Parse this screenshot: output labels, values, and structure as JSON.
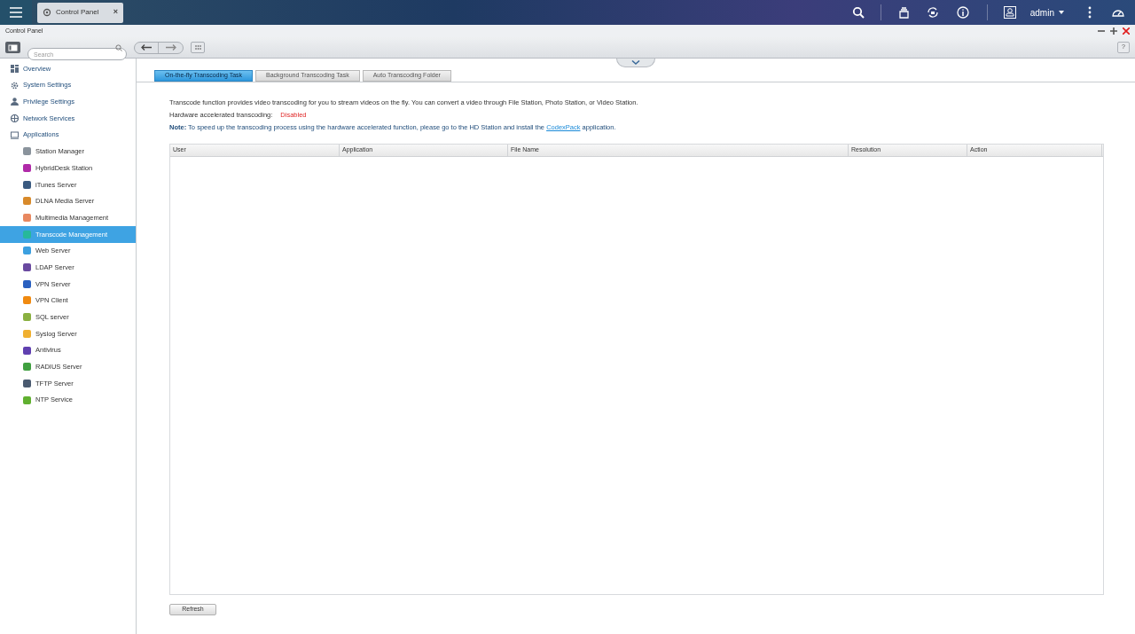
{
  "taskbar": {
    "app_tab": "Control Panel",
    "close": "×",
    "user": "admin"
  },
  "help": "?",
  "window": {
    "title": "Control Panel"
  },
  "search": {
    "placeholder": "Search"
  },
  "sidebar": {
    "items": [
      {
        "label": "Overview",
        "selected": false
      },
      {
        "label": "System Settings",
        "selected": false
      },
      {
        "label": "Privilege Settings",
        "selected": false
      },
      {
        "label": "Network Services",
        "selected": false
      },
      {
        "label": "Applications",
        "selected": false,
        "children": [
          {
            "label": "Station Manager",
            "selected": false
          },
          {
            "label": "HybridDesk Station",
            "selected": false
          },
          {
            "label": "iTunes Server",
            "selected": false
          },
          {
            "label": "DLNA Media Server",
            "selected": false
          },
          {
            "label": "Multimedia Management",
            "selected": false
          },
          {
            "label": "Transcode Management",
            "selected": true
          },
          {
            "label": "Web Server",
            "selected": false
          },
          {
            "label": "LDAP Server",
            "selected": false
          },
          {
            "label": "VPN Server",
            "selected": false
          },
          {
            "label": "VPN Client",
            "selected": false
          },
          {
            "label": "SQL server",
            "selected": false
          },
          {
            "label": "Syslog Server",
            "selected": false
          },
          {
            "label": "Antivirus",
            "selected": false
          },
          {
            "label": "RADIUS Server",
            "selected": false
          },
          {
            "label": "TFTP Server",
            "selected": false
          },
          {
            "label": "NTP Service",
            "selected": false
          }
        ]
      }
    ]
  },
  "tabs": [
    {
      "label": "On-the-fly Transcoding Task",
      "selected": true
    },
    {
      "label": "Background Transcoding Task",
      "selected": false
    },
    {
      "label": "Auto Transcoding Folder",
      "selected": false
    }
  ],
  "description": "Transcode function provides video transcoding for you to stream videos on the fly. You can convert a video through File Station, Photo Station, or Video Station.",
  "hardware": {
    "label": "Hardware accelerated transcoding:",
    "value": "Disabled",
    "enabled": false
  },
  "note": {
    "text": "**Note:** To speed up the transcoding process using the hardware accelerated function, please go to the HD Station and install the",
    "link": "CodexPack",
    "after": "application."
  },
  "table": {
    "columns": [
      "User",
      "Application",
      "File Name",
      "Resolution",
      "Action"
    ]
  },
  "buttons": [
    "Refresh"
  ]
}
